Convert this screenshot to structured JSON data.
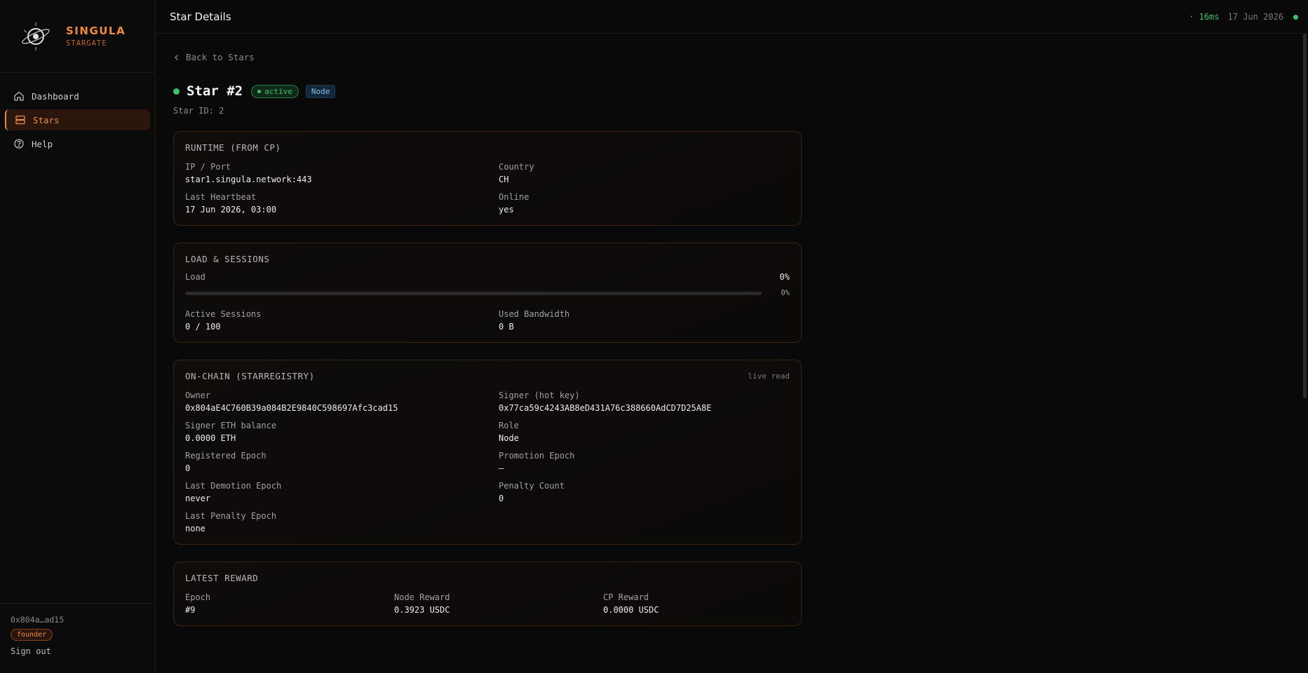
{
  "brand": {
    "name": "SINGULA",
    "sub": "STARGATE"
  },
  "nav": [
    {
      "label": "Dashboard",
      "icon": "home-icon",
      "active": false
    },
    {
      "label": "Stars",
      "icon": "server-icon",
      "active": true
    },
    {
      "label": "Help",
      "icon": "help-circle-icon",
      "active": false
    }
  ],
  "user": {
    "address": "0x804a…ad15",
    "role_badge": "founder",
    "signout": "Sign out"
  },
  "header": {
    "title": "Star Details",
    "latency": "· 16ms",
    "date": "17 Jun 2026"
  },
  "page": {
    "back": "Back to Stars",
    "title": "Star #2",
    "status": "active",
    "role_pill": "Node",
    "star_id": "Star ID: 2"
  },
  "runtime": {
    "title": "RUNTIME (FROM CP)",
    "fields": [
      {
        "label": "IP / Port",
        "value": "star1.singula.network:443"
      },
      {
        "label": "Country",
        "value": "CH"
      },
      {
        "label": "Last Heartbeat",
        "value": "17 Jun 2026, 03:00"
      },
      {
        "label": "Online",
        "value": "yes"
      }
    ]
  },
  "load": {
    "title": "LOAD & SESSIONS",
    "load_label": "Load",
    "load_value": "0%",
    "bar_pct": "0%",
    "load_fraction": 0,
    "fields": [
      {
        "label": "Active Sessions",
        "value": "0 / 100"
      },
      {
        "label": "Used Bandwidth",
        "value": "0 B"
      }
    ]
  },
  "onchain": {
    "title": "ON-CHAIN (STARREGISTRY)",
    "live": "live read",
    "fields": [
      {
        "label": "Owner",
        "value": "0x804aE4C760B39a084B2E9840C598697Afc3cad15"
      },
      {
        "label": "Signer (hot key)",
        "value": "0x77ca59c4243AB8eD431A76c388660AdCD7D25A8E"
      },
      {
        "label": "Signer ETH balance",
        "value": "0.0000 ETH"
      },
      {
        "label": "Role",
        "value": "Node"
      },
      {
        "label": "Registered Epoch",
        "value": "0"
      },
      {
        "label": "Promotion Epoch",
        "value": "—"
      },
      {
        "label": "Last Demotion Epoch",
        "value": "never"
      },
      {
        "label": "Penalty Count",
        "value": "0"
      },
      {
        "label": "Last Penalty Epoch",
        "value": "none"
      }
    ]
  },
  "reward": {
    "title": "LATEST REWARD",
    "fields": [
      {
        "label": "Epoch",
        "value": "#9"
      },
      {
        "label": "Node Reward",
        "value": "0.3923 USDC"
      },
      {
        "label": "CP Reward",
        "value": "0.0000 USDC"
      }
    ]
  },
  "colors": {
    "accent": "#f08a3c",
    "success": "#3cc36a",
    "background": "#090909"
  }
}
